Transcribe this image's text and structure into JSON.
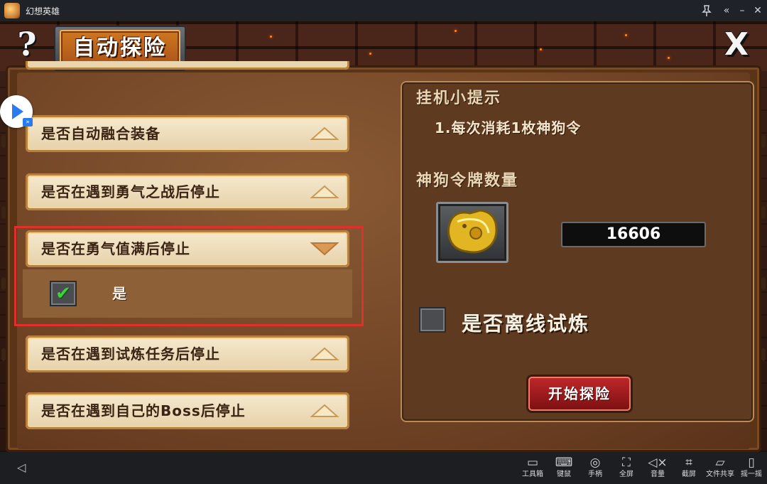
{
  "window": {
    "app_title": "幻想英雄",
    "controls": [
      "pin-icon",
      "collapse-icon",
      "minimize-icon",
      "close-icon"
    ]
  },
  "header": {
    "title": "自动探险",
    "help_label": "?",
    "close_label": "X"
  },
  "options": [
    {
      "label": "是否自动融合装备",
      "expanded": false
    },
    {
      "label": "是否在遇到勇气之战后停止",
      "expanded": false
    },
    {
      "label": "是否在勇气值满后停止",
      "expanded": true
    },
    {
      "label": "是否在遇到试炼任务后停止",
      "expanded": false
    },
    {
      "label": "是否在遇到自己的Boss后停止",
      "expanded": false
    }
  ],
  "expanded_option": {
    "checkbox_label": "是",
    "checked": true
  },
  "tips": {
    "title": "挂机小提示",
    "line1": "1.每次消耗1枚神狗令"
  },
  "token": {
    "title": "神狗令牌数量",
    "count": "16606"
  },
  "offline": {
    "label": "是否离线试炼",
    "checked": false
  },
  "start_button": {
    "label": "开始探险"
  },
  "toolbar": {
    "items": [
      {
        "label": "工具箱",
        "icon": "toolbox-icon"
      },
      {
        "label": "键鼠",
        "icon": "keyboard-icon"
      },
      {
        "label": "手柄",
        "icon": "gamepad-icon"
      },
      {
        "label": "全屏",
        "icon": "fullscreen-icon"
      },
      {
        "label": "音量",
        "icon": "volume-icon"
      },
      {
        "label": "截屏",
        "icon": "crop-icon"
      },
      {
        "label": "文件共享",
        "icon": "folder-icon"
      },
      {
        "label": "摇一摇",
        "icon": "shake-icon"
      }
    ]
  },
  "colors": {
    "highlight": "#e0302e",
    "start_button": "#b01e22",
    "check_green": "#3ed23e"
  }
}
